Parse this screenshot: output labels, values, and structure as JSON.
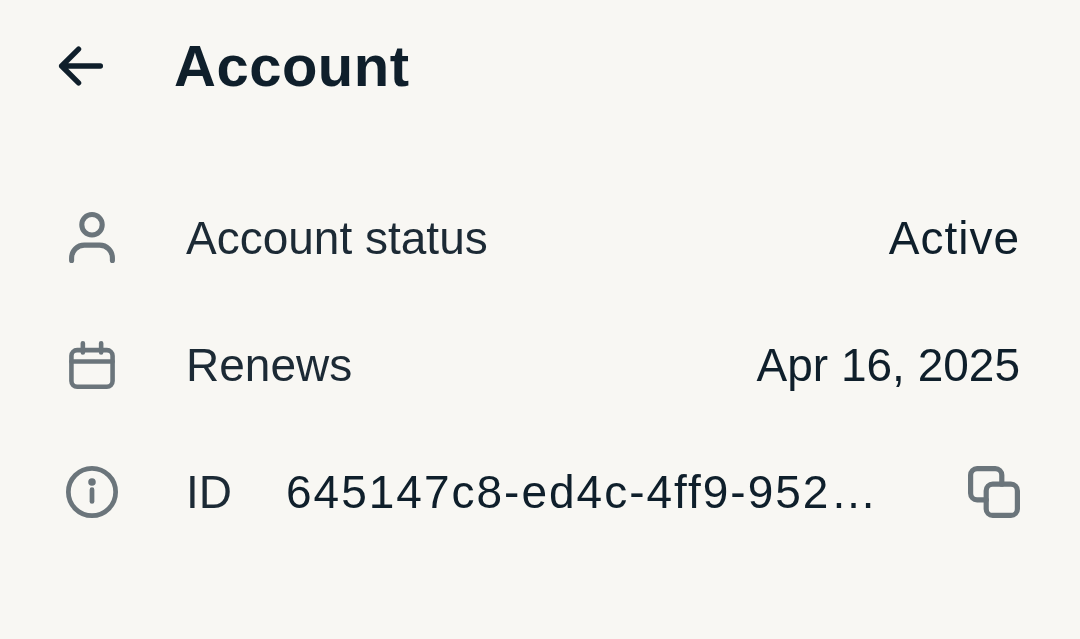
{
  "header": {
    "title": "Account"
  },
  "rows": [
    {
      "kind": "status",
      "label": "Account status",
      "value": "Active"
    },
    {
      "kind": "date",
      "label": "Renews",
      "value": "Apr 16, 2025"
    },
    {
      "kind": "id",
      "label": "ID",
      "value": "645147c8-ed4c-4ff9-952…"
    }
  ]
}
